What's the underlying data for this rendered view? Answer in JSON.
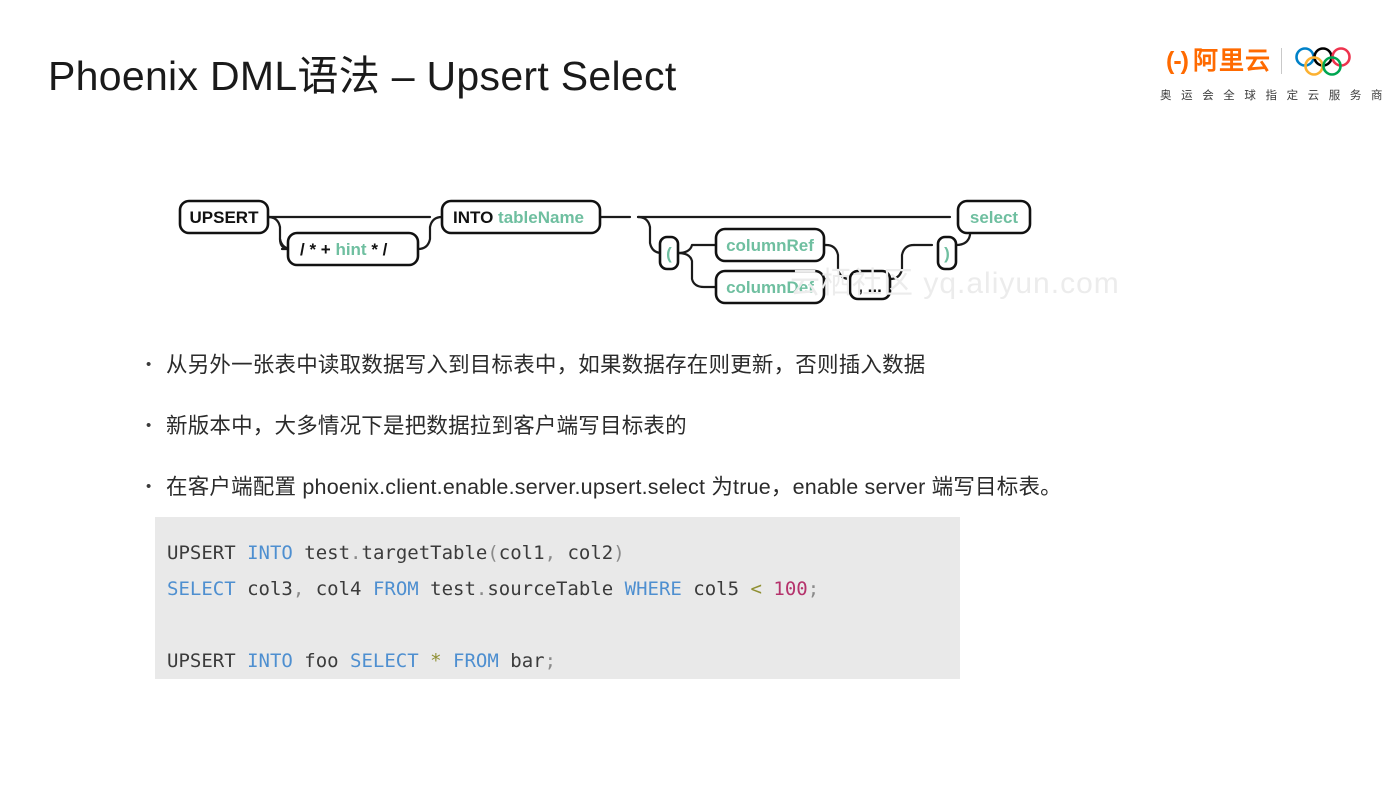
{
  "slide": {
    "title": "Phoenix DML语法 – Upsert Select",
    "watermark": "云栖社区 yq.aliyun.com",
    "background_color": "#ffffff"
  },
  "logo": {
    "brand_glyph": "(-)",
    "brand_name": "阿里云",
    "brand_color": "#ff6a00",
    "tagline": "奥 运 会 全 球 指 定 云 服 务 商",
    "rings": [
      {
        "name": "ring-blue",
        "color": "#0081c8"
      },
      {
        "name": "ring-black",
        "color": "#000000"
      },
      {
        "name": "ring-red",
        "color": "#ee334e"
      },
      {
        "name": "ring-yellow",
        "color": "#fcb131"
      },
      {
        "name": "ring-green",
        "color": "#00a651"
      }
    ]
  },
  "railroad": {
    "terminal_color": "#111111",
    "nonterminal_color": "#6fbfa0",
    "nodes": [
      {
        "id": "upsert",
        "label": "UPSERT",
        "kind": "terminal"
      },
      {
        "id": "hint",
        "label": "/ * + hint * /",
        "kind": "mixed",
        "parts": [
          {
            "text": "/ * + ",
            "kind": "terminal"
          },
          {
            "text": "hint",
            "kind": "nonterminal"
          },
          {
            "text": " * /",
            "kind": "terminal"
          }
        ]
      },
      {
        "id": "into",
        "label": "INTO tableName",
        "kind": "mixed",
        "parts": [
          {
            "text": "INTO ",
            "kind": "terminal"
          },
          {
            "text": "tableName",
            "kind": "nonterminal"
          }
        ]
      },
      {
        "id": "lparen",
        "label": "(",
        "kind": "nonterminal"
      },
      {
        "id": "columnref",
        "label": "columnRef",
        "kind": "nonterminal"
      },
      {
        "id": "columndef",
        "label": "columnDef",
        "kind": "nonterminal"
      },
      {
        "id": "comma",
        "label": ", ...",
        "kind": "terminal"
      },
      {
        "id": "rparen",
        "label": ")",
        "kind": "nonterminal"
      },
      {
        "id": "select",
        "label": "select",
        "kind": "nonterminal"
      }
    ]
  },
  "bullets": [
    {
      "marker": "•",
      "text": "从另外一张表中读取数据写入到目标表中，如果数据存在则更新，否则插入数据"
    },
    {
      "marker": "•",
      "text": "新版本中，大多情况下是把数据拉到客户端写目标表的"
    },
    {
      "marker": "•",
      "text": "在客户端配置 phoenix.client.enable.server.upsert.select 为true，enable server 端写目标表。"
    }
  ],
  "code": {
    "background_color": "#e9e9e9",
    "keyword_color": "#4e8fd0",
    "number_color": "#b5336c",
    "operator_color": "#8f8f32",
    "lines": [
      {
        "id": "line1",
        "tokens": [
          {
            "t": "UPSERT ",
            "c": "pl"
          },
          {
            "t": "INTO",
            "c": "kw"
          },
          {
            "t": " test",
            "c": "pl"
          },
          {
            "t": ".",
            "c": "punct"
          },
          {
            "t": "targetTable",
            "c": "pl"
          },
          {
            "t": "(",
            "c": "punct"
          },
          {
            "t": "col1",
            "c": "pl"
          },
          {
            "t": ",",
            "c": "punct"
          },
          {
            "t": " col2",
            "c": "pl"
          },
          {
            "t": ")",
            "c": "punct"
          }
        ]
      },
      {
        "id": "line2",
        "tokens": [
          {
            "t": "SELECT",
            "c": "kw"
          },
          {
            "t": " col3",
            "c": "pl"
          },
          {
            "t": ",",
            "c": "punct"
          },
          {
            "t": " col4 ",
            "c": "pl"
          },
          {
            "t": "FROM",
            "c": "kw"
          },
          {
            "t": " test",
            "c": "pl"
          },
          {
            "t": ".",
            "c": "punct"
          },
          {
            "t": "sourceTable ",
            "c": "pl"
          },
          {
            "t": "WHERE",
            "c": "kw"
          },
          {
            "t": " col5 ",
            "c": "pl"
          },
          {
            "t": "<",
            "c": "op"
          },
          {
            "t": " ",
            "c": "pl"
          },
          {
            "t": "100",
            "c": "num"
          },
          {
            "t": ";",
            "c": "punct"
          }
        ]
      },
      {
        "id": "line3",
        "tokens": []
      },
      {
        "id": "line4",
        "tokens": [
          {
            "t": "UPSERT ",
            "c": "pl"
          },
          {
            "t": "INTO",
            "c": "kw"
          },
          {
            "t": " foo ",
            "c": "pl"
          },
          {
            "t": "SELECT",
            "c": "kw"
          },
          {
            "t": " ",
            "c": "pl"
          },
          {
            "t": "*",
            "c": "op"
          },
          {
            "t": " ",
            "c": "pl"
          },
          {
            "t": "FROM",
            "c": "kw"
          },
          {
            "t": " bar",
            "c": "pl"
          },
          {
            "t": ";",
            "c": "punct"
          }
        ]
      }
    ]
  }
}
